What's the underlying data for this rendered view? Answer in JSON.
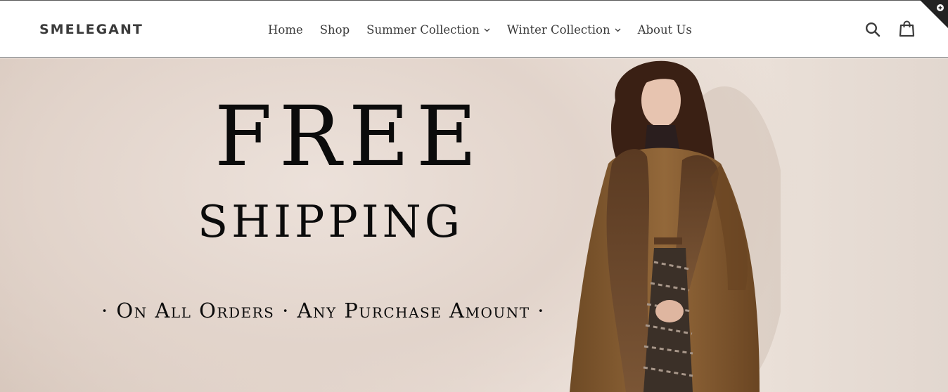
{
  "header": {
    "logo": "SMELEGANT",
    "nav": [
      {
        "label": "Home",
        "has_dropdown": false
      },
      {
        "label": "Shop",
        "has_dropdown": false
      },
      {
        "label": "Summer Collection",
        "has_dropdown": true
      },
      {
        "label": "Winter Collection",
        "has_dropdown": true
      },
      {
        "label": "About Us",
        "has_dropdown": false
      }
    ],
    "icons": {
      "search": "search-icon",
      "cart": "shopping-bag-icon",
      "corner": "plus-circle-icon"
    }
  },
  "hero": {
    "title": "FREE",
    "subtitle": "SHIPPING",
    "tagline": "· On All Orders · Any Purchase Amount ·"
  },
  "colors": {
    "text": "#3a3a3a",
    "hero_text": "#0b0b0b",
    "header_bg": "#ffffff",
    "hero_bg": "#e8ddd5",
    "coat": "#8a5f32",
    "corner_badge": "#222222"
  }
}
